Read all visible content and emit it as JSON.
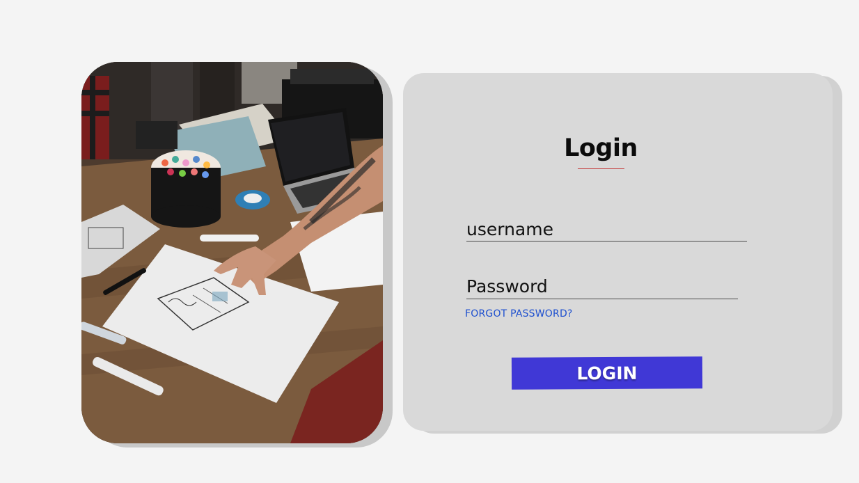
{
  "photo": {
    "icon": "desk-sketch-photo"
  },
  "login": {
    "title": "Login",
    "username_placeholder": "username",
    "password_placeholder": "Password",
    "forgot_label": "FORGOT PASSWORD?",
    "button_label": "LOGIN"
  },
  "colors": {
    "background": "#f4f4f4",
    "card": "#d9d9d9",
    "button": "#4038d6",
    "link": "#1d4fcf",
    "title_underline": "#c43a3a"
  }
}
